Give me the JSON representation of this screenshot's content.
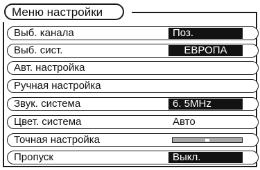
{
  "menu": {
    "title": "Меню настройки",
    "items": [
      {
        "label": "Выб. канала",
        "value": "Поз.",
        "style": "dark"
      },
      {
        "label": "Выб. сист.",
        "value": "ЕВРОПА",
        "style": "dark"
      },
      {
        "label": "Авт. настройка",
        "value": null,
        "style": "none"
      },
      {
        "label": "Ручная настройка",
        "value": null,
        "style": "none"
      },
      {
        "label": "Звук. система",
        "value": "6. 5MHz",
        "style": "dark"
      },
      {
        "label": "Цвет. система",
        "value": "Авто",
        "style": "plain"
      },
      {
        "label": "Точная настройка",
        "value": null,
        "style": "bar"
      },
      {
        "label": "Пропуск",
        "value": "Выкл.",
        "style": "dark"
      }
    ],
    "fine_tuning_level": 0.5
  }
}
